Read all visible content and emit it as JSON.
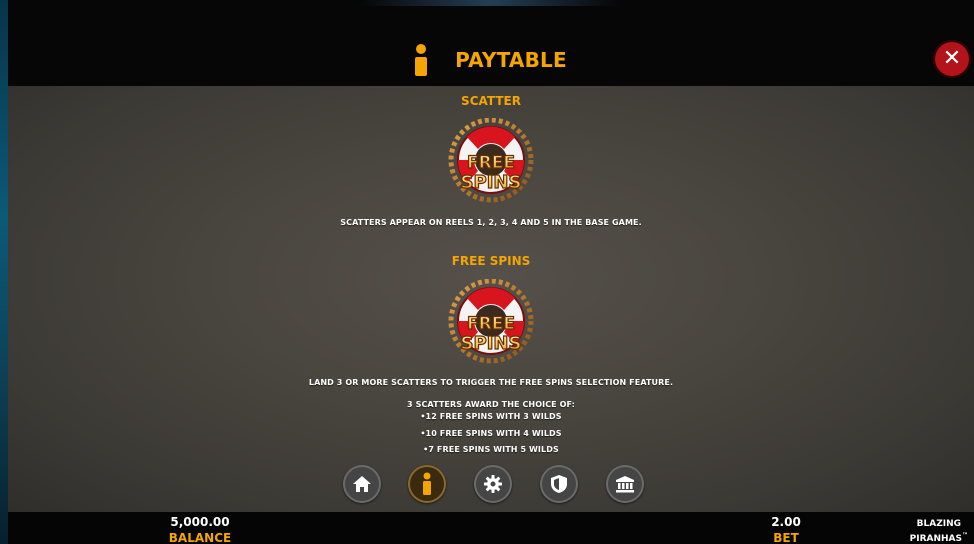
{
  "header": {
    "title": "PAYTABLE",
    "info_icon": "info-icon",
    "close_icon": "close-icon"
  },
  "sections": [
    {
      "title": "SCATTER",
      "symbol": {
        "line1": "FREE",
        "line2": "SPINS"
      },
      "lines": [
        "SCATTERS APPEAR ON REELS 1, 2, 3, 4 AND 5 IN THE BASE GAME."
      ]
    },
    {
      "title": "FREE SPINS",
      "symbol": {
        "line1": "FREE",
        "line2": "SPINS"
      },
      "lines": [
        "LAND 3 OR MORE SCATTERS TO TRIGGER THE FREE SPINS SELECTION FEATURE.",
        "3 SCATTERS AWARD THE CHOICE OF:",
        "•12 FREE SPINS WITH 3 WILDS",
        "•10 FREE SPINS WITH 4 WILDS",
        "•7 FREE SPINS WITH 5 WILDS"
      ]
    }
  ],
  "nav": [
    {
      "icon": "home-icon",
      "active": false
    },
    {
      "icon": "info-icon",
      "active": true
    },
    {
      "icon": "gear-icon",
      "active": false
    },
    {
      "icon": "shield-icon",
      "active": false
    },
    {
      "icon": "bank-icon",
      "active": false
    }
  ],
  "footer": {
    "balance_value": "5,000.00",
    "balance_label": "BALANCE",
    "bet_value": "2.00",
    "bet_label": "BET",
    "brand_line1": "BLAZING",
    "brand_line2": "PIRANHAS",
    "brand_mark": "™"
  },
  "colors": {
    "accent": "#f5a500",
    "close": "#b3141b",
    "panel": "#4a4640"
  }
}
